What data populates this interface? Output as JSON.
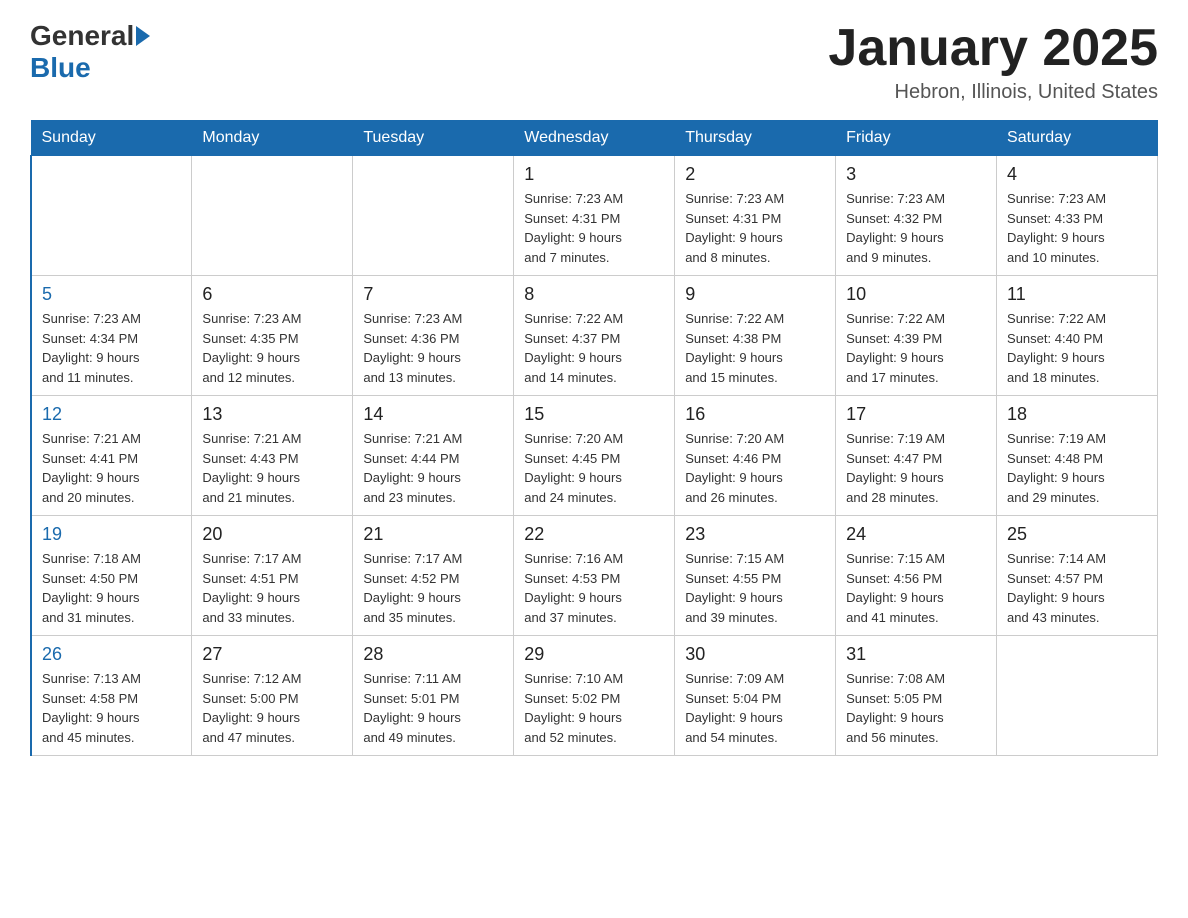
{
  "header": {
    "logo_general": "General",
    "logo_blue": "Blue",
    "title": "January 2025",
    "location": "Hebron, Illinois, United States"
  },
  "days_of_week": [
    "Sunday",
    "Monday",
    "Tuesday",
    "Wednesday",
    "Thursday",
    "Friday",
    "Saturday"
  ],
  "weeks": [
    [
      {
        "day": "",
        "info": ""
      },
      {
        "day": "",
        "info": ""
      },
      {
        "day": "",
        "info": ""
      },
      {
        "day": "1",
        "info": "Sunrise: 7:23 AM\nSunset: 4:31 PM\nDaylight: 9 hours\nand 7 minutes."
      },
      {
        "day": "2",
        "info": "Sunrise: 7:23 AM\nSunset: 4:31 PM\nDaylight: 9 hours\nand 8 minutes."
      },
      {
        "day": "3",
        "info": "Sunrise: 7:23 AM\nSunset: 4:32 PM\nDaylight: 9 hours\nand 9 minutes."
      },
      {
        "day": "4",
        "info": "Sunrise: 7:23 AM\nSunset: 4:33 PM\nDaylight: 9 hours\nand 10 minutes."
      }
    ],
    [
      {
        "day": "5",
        "info": "Sunrise: 7:23 AM\nSunset: 4:34 PM\nDaylight: 9 hours\nand 11 minutes."
      },
      {
        "day": "6",
        "info": "Sunrise: 7:23 AM\nSunset: 4:35 PM\nDaylight: 9 hours\nand 12 minutes."
      },
      {
        "day": "7",
        "info": "Sunrise: 7:23 AM\nSunset: 4:36 PM\nDaylight: 9 hours\nand 13 minutes."
      },
      {
        "day": "8",
        "info": "Sunrise: 7:22 AM\nSunset: 4:37 PM\nDaylight: 9 hours\nand 14 minutes."
      },
      {
        "day": "9",
        "info": "Sunrise: 7:22 AM\nSunset: 4:38 PM\nDaylight: 9 hours\nand 15 minutes."
      },
      {
        "day": "10",
        "info": "Sunrise: 7:22 AM\nSunset: 4:39 PM\nDaylight: 9 hours\nand 17 minutes."
      },
      {
        "day": "11",
        "info": "Sunrise: 7:22 AM\nSunset: 4:40 PM\nDaylight: 9 hours\nand 18 minutes."
      }
    ],
    [
      {
        "day": "12",
        "info": "Sunrise: 7:21 AM\nSunset: 4:41 PM\nDaylight: 9 hours\nand 20 minutes."
      },
      {
        "day": "13",
        "info": "Sunrise: 7:21 AM\nSunset: 4:43 PM\nDaylight: 9 hours\nand 21 minutes."
      },
      {
        "day": "14",
        "info": "Sunrise: 7:21 AM\nSunset: 4:44 PM\nDaylight: 9 hours\nand 23 minutes."
      },
      {
        "day": "15",
        "info": "Sunrise: 7:20 AM\nSunset: 4:45 PM\nDaylight: 9 hours\nand 24 minutes."
      },
      {
        "day": "16",
        "info": "Sunrise: 7:20 AM\nSunset: 4:46 PM\nDaylight: 9 hours\nand 26 minutes."
      },
      {
        "day": "17",
        "info": "Sunrise: 7:19 AM\nSunset: 4:47 PM\nDaylight: 9 hours\nand 28 minutes."
      },
      {
        "day": "18",
        "info": "Sunrise: 7:19 AM\nSunset: 4:48 PM\nDaylight: 9 hours\nand 29 minutes."
      }
    ],
    [
      {
        "day": "19",
        "info": "Sunrise: 7:18 AM\nSunset: 4:50 PM\nDaylight: 9 hours\nand 31 minutes."
      },
      {
        "day": "20",
        "info": "Sunrise: 7:17 AM\nSunset: 4:51 PM\nDaylight: 9 hours\nand 33 minutes."
      },
      {
        "day": "21",
        "info": "Sunrise: 7:17 AM\nSunset: 4:52 PM\nDaylight: 9 hours\nand 35 minutes."
      },
      {
        "day": "22",
        "info": "Sunrise: 7:16 AM\nSunset: 4:53 PM\nDaylight: 9 hours\nand 37 minutes."
      },
      {
        "day": "23",
        "info": "Sunrise: 7:15 AM\nSunset: 4:55 PM\nDaylight: 9 hours\nand 39 minutes."
      },
      {
        "day": "24",
        "info": "Sunrise: 7:15 AM\nSunset: 4:56 PM\nDaylight: 9 hours\nand 41 minutes."
      },
      {
        "day": "25",
        "info": "Sunrise: 7:14 AM\nSunset: 4:57 PM\nDaylight: 9 hours\nand 43 minutes."
      }
    ],
    [
      {
        "day": "26",
        "info": "Sunrise: 7:13 AM\nSunset: 4:58 PM\nDaylight: 9 hours\nand 45 minutes."
      },
      {
        "day": "27",
        "info": "Sunrise: 7:12 AM\nSunset: 5:00 PM\nDaylight: 9 hours\nand 47 minutes."
      },
      {
        "day": "28",
        "info": "Sunrise: 7:11 AM\nSunset: 5:01 PM\nDaylight: 9 hours\nand 49 minutes."
      },
      {
        "day": "29",
        "info": "Sunrise: 7:10 AM\nSunset: 5:02 PM\nDaylight: 9 hours\nand 52 minutes."
      },
      {
        "day": "30",
        "info": "Sunrise: 7:09 AM\nSunset: 5:04 PM\nDaylight: 9 hours\nand 54 minutes."
      },
      {
        "day": "31",
        "info": "Sunrise: 7:08 AM\nSunset: 5:05 PM\nDaylight: 9 hours\nand 56 minutes."
      },
      {
        "day": "",
        "info": ""
      }
    ]
  ]
}
